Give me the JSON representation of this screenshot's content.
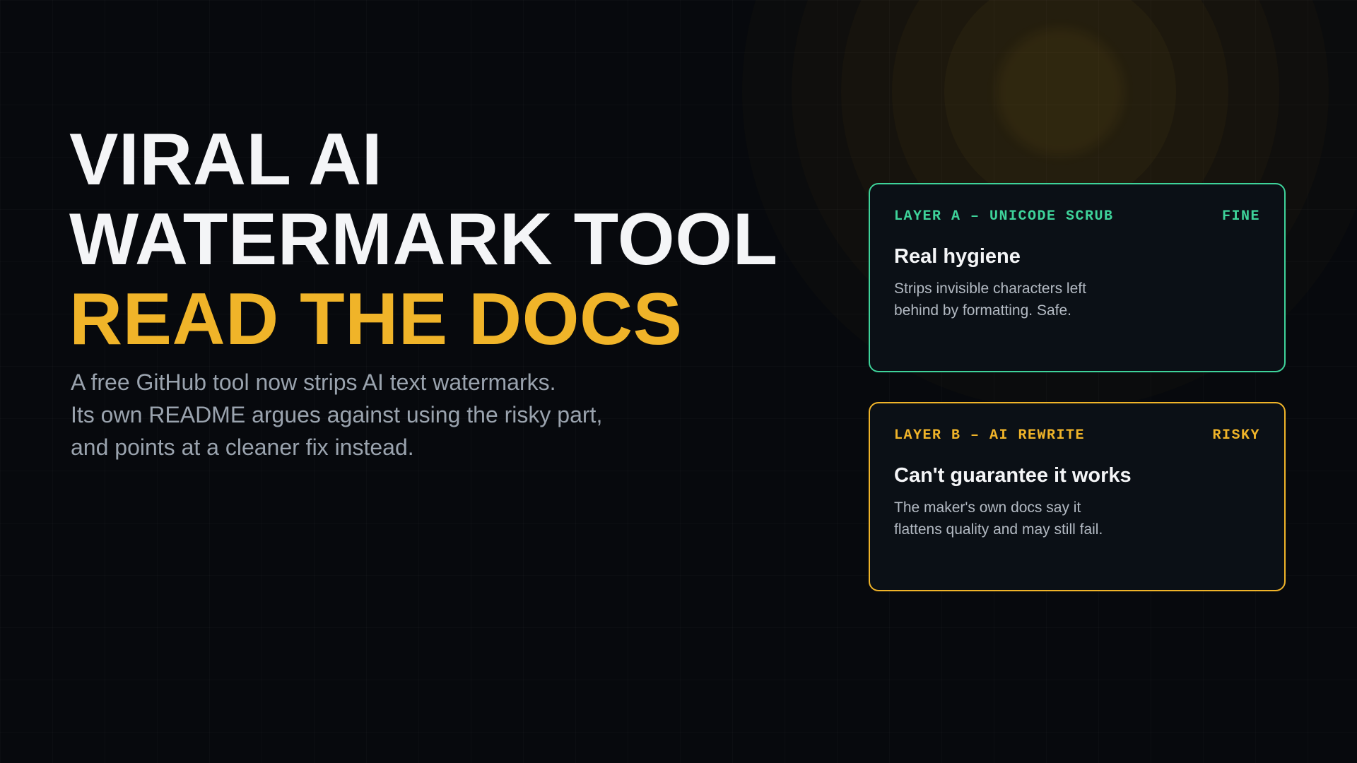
{
  "headline": {
    "line1": "VIRAL AI",
    "line2": "WATERMARK TOOL",
    "line3": "READ THE DOCS"
  },
  "subtitle": {
    "line1": "A free GitHub tool now strips AI text watermarks.",
    "line2": "Its own README argues against using the risky part,",
    "line3": "and points at a cleaner fix instead."
  },
  "cards": [
    {
      "label": "LAYER A – UNICODE SCRUB",
      "status": "FINE",
      "title": "Real hygiene",
      "body_line1": "Strips invisible characters left",
      "body_line2": "behind by formatting. Safe."
    },
    {
      "label": "LAYER B – AI REWRITE",
      "status": "RISKY",
      "title": "Can't guarantee it works",
      "body_line1": "The maker's own docs say it",
      "body_line2": "flattens quality and may still fail."
    }
  ],
  "colors": {
    "background": "#07090d",
    "accent": "#f0b429",
    "safe": "#3ed39a",
    "text_primary": "#f4f5f7",
    "text_muted": "#9aa3ae"
  }
}
